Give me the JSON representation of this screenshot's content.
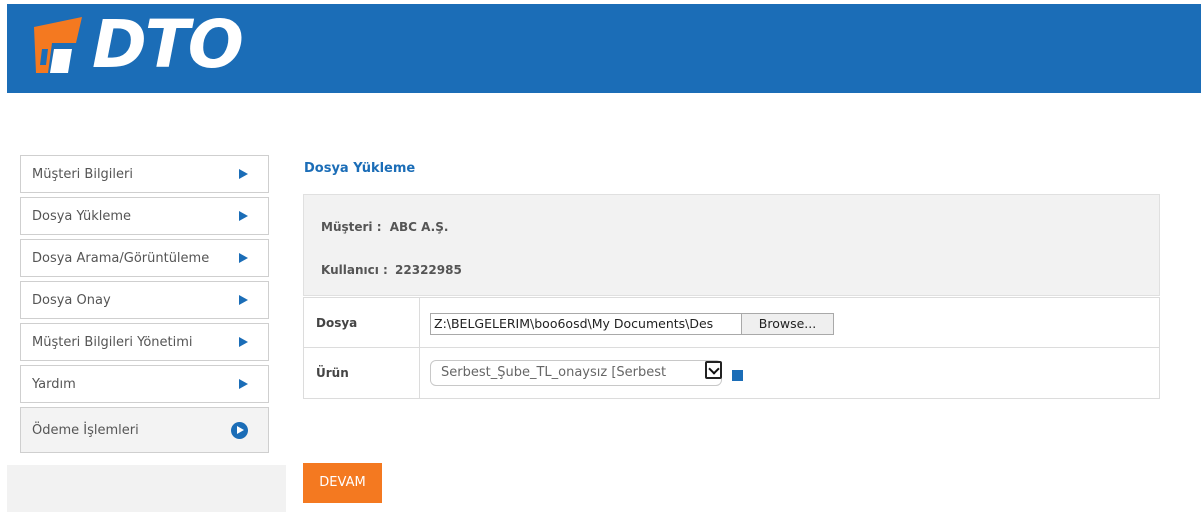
{
  "header": {
    "logo_text": "DTO",
    "brand_color": "#1b6db7",
    "logo_mark_color": "#f47920"
  },
  "sidebar": {
    "items": [
      {
        "label": "Müşteri Bilgileri",
        "icon": "triangle-right-icon"
      },
      {
        "label": "Dosya Yükleme",
        "icon": "triangle-right-icon"
      },
      {
        "label": "Dosya Arama/Görüntüleme",
        "icon": "triangle-right-icon"
      },
      {
        "label": "Dosya Onay",
        "icon": "triangle-right-icon"
      },
      {
        "label": "Müşteri Bilgileri Yönetimi",
        "icon": "triangle-right-icon"
      },
      {
        "label": "Yardım",
        "icon": "triangle-right-icon"
      },
      {
        "label": "Ödeme İşlemleri",
        "icon": "circle-play-icon"
      }
    ]
  },
  "main": {
    "title": "Dosya Yükleme",
    "info": {
      "customer_label": "Müşteri :",
      "customer_value": "ABC A.Ş.",
      "user_label": "Kullanıcı :",
      "user_value": "22322985"
    },
    "form": {
      "file_label": "Dosya",
      "file_value": "Z:\\BELGELERIM\\boo6osd\\My Documents\\Des",
      "browse_label": "Browse...",
      "product_label": "Ürün",
      "product_value": "Serbest_Şube_TL_onaysız [Serbest",
      "help_icon": "help-icon"
    },
    "submit_label": "DEVAM",
    "submit_color": "#f47920"
  }
}
